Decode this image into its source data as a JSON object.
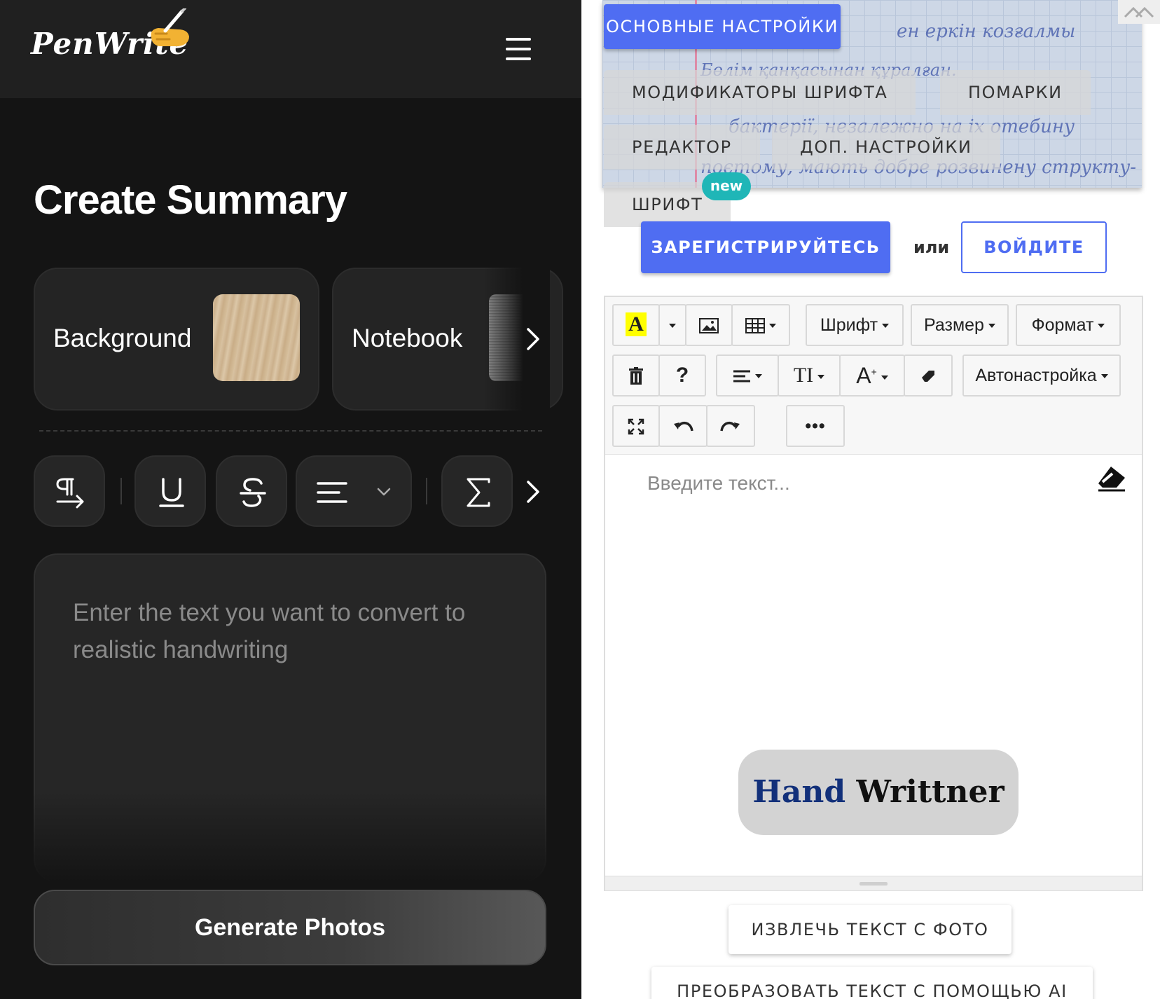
{
  "left": {
    "logo_text": "PenWrite",
    "menu_icon": "hamburger-menu-icon",
    "title": "Create Summary",
    "cards": [
      {
        "label": "Background",
        "thumb": "wood-texture"
      },
      {
        "label": "Notebook",
        "thumb": "spiral-notebook"
      }
    ],
    "tools": [
      "paragraph-direction-icon",
      "underline-icon",
      "strikethrough-icon",
      "align-left-icon",
      "sigma-icon"
    ],
    "textarea_placeholder": "Enter the text you want to convert to realistic handwriting",
    "generate_label": "Generate Photos"
  },
  "right": {
    "tabs": {
      "main_settings": "ОСНОВНЫЕ НАСТРОЙКИ",
      "font_modifiers": "МОДИФИКАТОРЫ ШРИФТА",
      "blots": "ПОМАРКИ",
      "editor": "РЕДАКТОР",
      "extra_settings": "ДОП. НАСТРОЙКИ",
      "font": "ШРИФТ"
    },
    "new_badge": "new",
    "register_label": "ЗАРЕГИСТРИРУЙТЕСЬ",
    "or_label": "или",
    "login_label": "ВОЙДИТЕ",
    "toolbar": {
      "font_color_label": "A",
      "font_label": "Шрифт",
      "size_label": "Размер",
      "format_label": "Формат",
      "help_label": "?",
      "autotune_label": "Автонастройка",
      "more_label": "•••",
      "text_size_label": "TI",
      "font_size_label": "A"
    },
    "editor_placeholder": "Введите текст...",
    "logo_part1": "Hand",
    "logo_part2": "Writtner",
    "extract_label": "ИЗВЛЕЧЬ ТЕКСТ С ФОТО",
    "ai_label": "ПРЕОБРАЗОВАТЬ ТЕКСТ С ПОМОЩЬЮ AI"
  },
  "colors": {
    "accent_blue": "#4f6df2",
    "teal_badge": "#1fb6b7",
    "dark_bg": "#141414",
    "header_bg": "#202020"
  }
}
